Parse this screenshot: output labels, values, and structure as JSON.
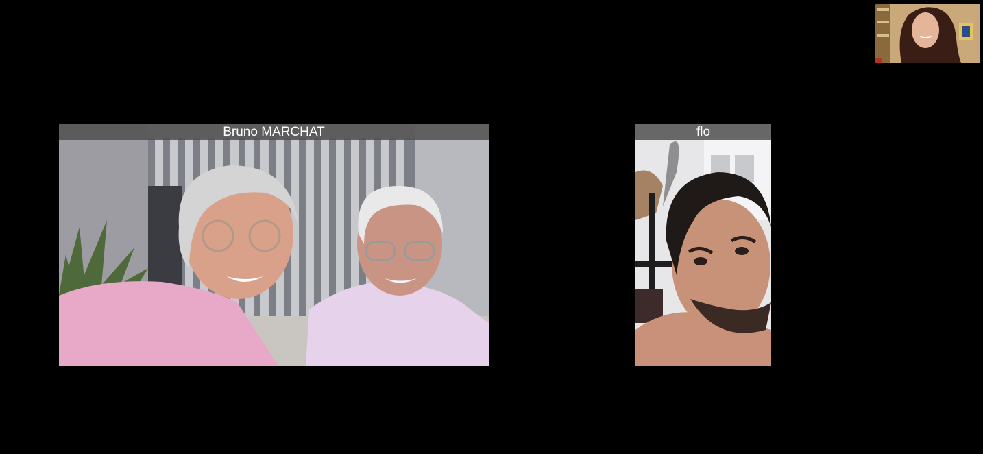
{
  "participants": [
    {
      "name": "Bruno MARCHAT"
    },
    {
      "name": "flo"
    }
  ],
  "self_view": {
    "name": ""
  },
  "colors": {
    "background": "#000000",
    "name_bar": "#505050",
    "name_text": "#ffffff"
  }
}
